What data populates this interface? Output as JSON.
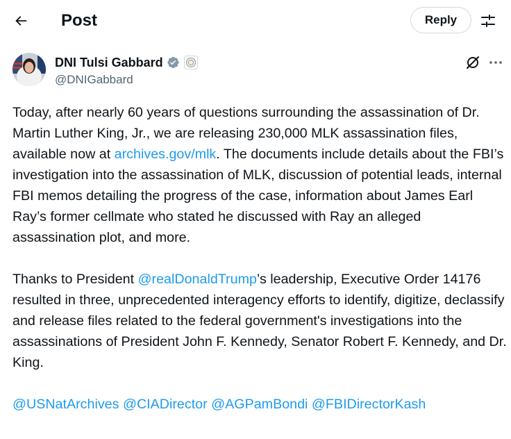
{
  "header": {
    "title": "Post",
    "reply_label": "Reply"
  },
  "author": {
    "display_name": "DNI Tulsi Gabbard",
    "handle": "@DNIGabbard",
    "verified_icon": "verified-badge-icon",
    "affiliate_icon": "government-seal-icon"
  },
  "tweet": {
    "p1": {
      "before_link": "Today, after nearly 60 years of questions surrounding the assassination of Dr. Martin Luther King, Jr., we are releasing 230,000 MLK assassination files, available now at ",
      "link": "archives.gov/mlk",
      "after_link": ". The documents include details about the FBI’s investigation into the assassination of MLK, discussion of potential leads, internal FBI memos detailing the progress of the case, information about James Earl Ray’s former cellmate who stated he discussed with Ray an alleged assassination plot, and more."
    },
    "p2": {
      "before_mention": "Thanks to President ",
      "mention": "@realDonaldTrump",
      "after_mention": "’s leadership, Executive Order 14176 resulted in three, unprecedented interagency efforts to identify, digitize, declassify and release files related to the federal government's investigations into the assassinations of President John F. Kennedy, Senator Robert F. Kennedy, and Dr. King."
    },
    "mentions": [
      "@USNatArchives",
      "@CIADirector",
      "@AGPamBondi",
      "@FBIDirectorKash"
    ]
  },
  "colors": {
    "link": "#1d9bf0",
    "text": "#0f1419",
    "secondary": "#536471",
    "verified": "#829aab"
  }
}
